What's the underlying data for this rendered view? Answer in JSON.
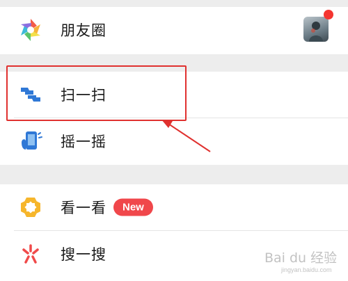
{
  "menu": {
    "moments": {
      "label": "朋友圈",
      "icon": "aperture-icon"
    },
    "scan": {
      "label": "扫一扫",
      "icon": "scan-icon"
    },
    "shake": {
      "label": "摇一摇",
      "icon": "shake-phone-icon"
    },
    "top_stories": {
      "label": "看一看",
      "icon": "top-stories-icon",
      "badge": "New"
    },
    "search": {
      "label": "搜一搜",
      "icon": "search-sparkle-icon"
    }
  },
  "colors": {
    "highlight": "#e0312f",
    "badge": "#f0474b",
    "notification_dot": "#f43530"
  },
  "watermark": {
    "main": "Bai du 经验",
    "sub": "jingyan.baidu.com"
  }
}
